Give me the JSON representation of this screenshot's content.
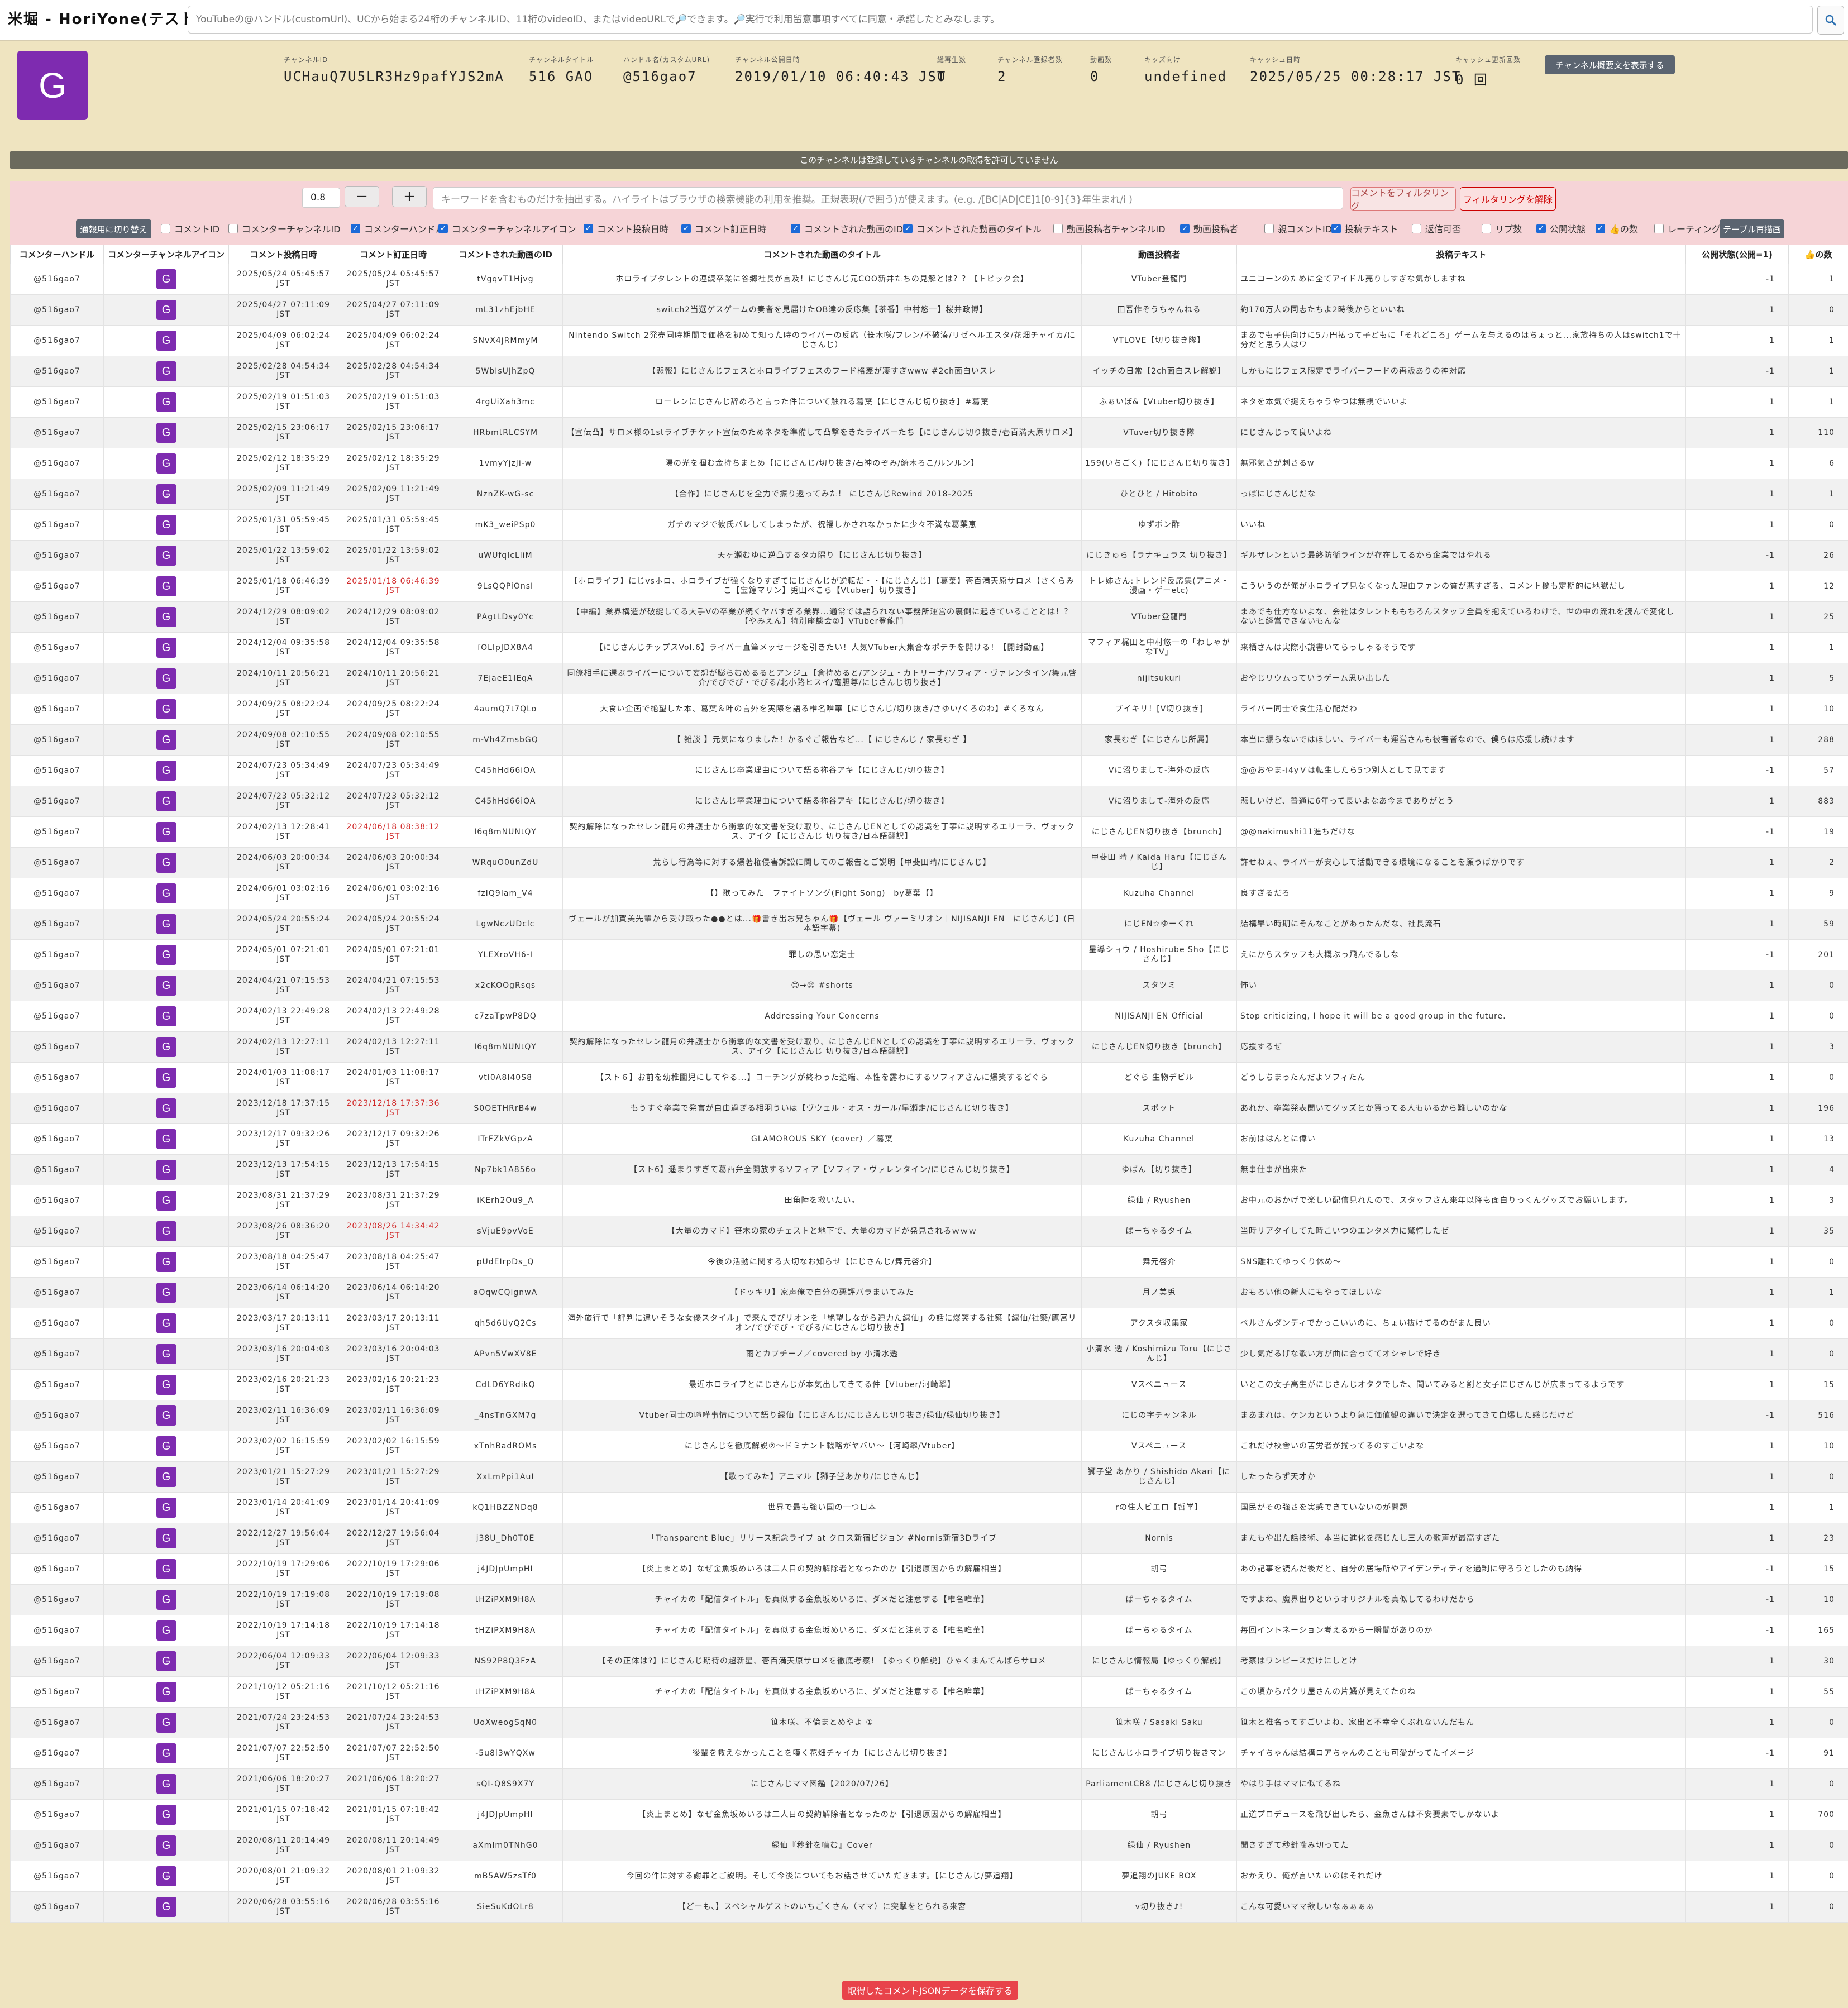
{
  "app": {
    "title": "米堀 - HoriYone(テスト中)",
    "search_placeholder": "YouTubeの@ハンドル(customUrl)、UCから始まる24桁のチャンネルID、11桁のvideoID、またはvideoURLで🔎できます。🔎実行で利用留意事項すべてに同意・承諾したとみなします。",
    "search_icon": "search-icon"
  },
  "channel": {
    "avatar_letter": "G",
    "fields": [
      {
        "label": "チャンネルID",
        "value": "UCHauQ7U5LR3Hz9pafYJS2mA"
      },
      {
        "label": "チャンネルタイトル",
        "value": "516 GAO"
      },
      {
        "label": "ハンドル名(カスタムURL)",
        "value": "@516gao7"
      },
      {
        "label": "チャンネル公開日時",
        "value": "2019/01/10 06:40:43 JST"
      },
      {
        "label": "総再生数",
        "value": "0"
      },
      {
        "label": "チャンネル登録者数",
        "value": "2"
      },
      {
        "label": "動画数",
        "value": "0"
      },
      {
        "label": "キッズ向け",
        "value": "undefined"
      },
      {
        "label": "キャッシュ日時",
        "value": "2025/05/25 00:28:17 JST"
      },
      {
        "label": "キャッシュ更新回数",
        "value": "0 回"
      }
    ],
    "desc_button": "チャンネル概要文を表示する"
  },
  "banner": "このチャンネルは登録しているチャンネルの取得を許可していません",
  "filter": {
    "threshold": "0.8",
    "minus": "−",
    "plus": "+",
    "keyword_placeholder": "キーワードを含むものだけを抽出する。ハイライトはブラウザの検索機能の利用を推奨。正規表現(/で囲う)が使えます。(e.g. /[BC|AD|CE]1[0-9]{3}年生まれ/i )",
    "filter_button": "コメントをフィルタリング",
    "clear_button": "フィルタリングを解除",
    "mode_button": "通報用に切り替え",
    "redraw_button": "テーブル再描画",
    "checkboxes": [
      {
        "label": "コメントID",
        "checked": false
      },
      {
        "label": "コメンターチャンネルID",
        "checked": false
      },
      {
        "label": "コメンターハンドル",
        "checked": true
      },
      {
        "label": "コメンターチャンネルアイコン",
        "checked": true
      },
      {
        "label": "コメント投稿日時",
        "checked": true
      },
      {
        "label": "コメント訂正日時",
        "checked": true
      },
      {
        "label": "コメントされた動画のID",
        "checked": true
      },
      {
        "label": "コメントされた動画のタイトル",
        "checked": true
      },
      {
        "label": "動画投稿者チャンネルID",
        "checked": false
      },
      {
        "label": "動画投稿者",
        "checked": true
      },
      {
        "label": "親コメントID",
        "checked": false
      },
      {
        "label": "投稿テキスト",
        "checked": true
      },
      {
        "label": "返信可否",
        "checked": false
      },
      {
        "label": "リプ数",
        "checked": false
      },
      {
        "label": "公開状態",
        "checked": true
      },
      {
        "label": "👍の数",
        "checked": true
      },
      {
        "label": "レーティング",
        "checked": false
      }
    ]
  },
  "table": {
    "headers": [
      "コメンターハンドル",
      "コメンターチャンネルアイコン",
      "コメント投稿日時",
      "コメント訂正日時",
      "コメントされた動画のID",
      "コメントされた動画のタイトル",
      "動画投稿者",
      "投稿テキスト",
      "公開状態(公開=1)",
      "👍の数"
    ],
    "rows": [
      [
        "@516gao7",
        "G",
        "2025/05/24 05:45:57 JST",
        "2025/05/24 05:45:57 JST",
        "tVgqvT1Hjvg",
        "ホロライブタレントの連続卒業に谷郷社長が言及！にじさんじ元COO新井たちの見解とは？？【トピック会】",
        "VTuber登龍門",
        "ユニコーンのために全てアイドル売りしすぎな気がしますね",
        "-1",
        "1",
        false
      ],
      [
        "@516gao7",
        "G",
        "2025/04/27 07:11:09 JST",
        "2025/04/27 07:11:09 JST",
        "mL31zhEjbHE",
        "switch2当選ゲスゲームの奏者を見届けたOB達の反応集【茶番】中村悠一】桜井政博】",
        "田吾作ぞうちゃんねる",
        "約170万人の同志たちよ2時後からといいね",
        "1",
        "0",
        false
      ],
      [
        "@516gao7",
        "G",
        "2025/04/09 06:02:24 JST",
        "2025/04/09 06:02:24 JST",
        "SNvX4jRMmyM",
        "Nintendo Switch 2発売同時期間で価格を初めて知った時のライバーの反応（笹木咲/フレン/不破湊/リゼヘルエスタ/花畑チャイカ/にじさんじ）",
        "VTLOVE【切り抜き隊】",
        "まあでも子供向けに5万円払って子どもに「それどころ」ゲームを与えるのはちょっと...家族持ちの人はswitch1で十分だと思う人はワ",
        "1",
        "1",
        false
      ],
      [
        "@516gao7",
        "G",
        "2025/02/28 04:54:34 JST",
        "2025/02/28 04:54:34 JST",
        "5WbIsUJhZpQ",
        "【悲報】にじさんじフェスとホロライブフェスのフード格差が凄すぎwww #2ch面白いスレ",
        "イッチの日常【2ch面白スレ解説】",
        "しかもにじフェス限定でライバーフードの再販ありの神対応",
        "-1",
        "1",
        false
      ],
      [
        "@516gao7",
        "G",
        "2025/02/19 01:51:03 JST",
        "2025/02/19 01:51:03 JST",
        "4rgUiXah3mc",
        "ローレンにじさんじ辞めろと言った件について触れる葛葉【にじさんじ切り抜き】#葛葉",
        "ふぁいぼ&【Vtuber切り抜き】",
        "ネタを本気で捉えちゃうやつは無視でいいよ",
        "1",
        "1",
        false
      ],
      [
        "@516gao7",
        "G",
        "2025/02/15 23:06:17 JST",
        "2025/02/15 23:06:17 JST",
        "HRbmtRLCSYM",
        "【宣伝凸】サロメ様の1stライブチケット宣伝のためネタを準備して凸撃をきたライバーたち【にじさんじ切り抜き/壱百満天原サロメ】",
        "VTuver切り抜き隊",
        "にじさんじって良いよね",
        "1",
        "110",
        false
      ],
      [
        "@516gao7",
        "G",
        "2025/02/12 18:35:29 JST",
        "2025/02/12 18:35:29 JST",
        "1vmyYjzJi-w",
        "陽の光を掴む金持ちまとめ【にじさんじ/切り抜き/石神のぞみ/綺木ろこ/ルンルン】",
        "159(いちごく)【にじさんじ切り抜き】",
        "無邪気さが刺さるw",
        "1",
        "6",
        false
      ],
      [
        "@516gao7",
        "G",
        "2025/02/09 11:21:49 JST",
        "2025/02/09 11:21:49 JST",
        "NznZK-wG-sc",
        "【合作】にじさんじを全力で振り返ってみた！ にじさんじRewind 2018-2025",
        "ひとひと / Hitobito",
        "っぱにじさんじだな",
        "1",
        "1",
        false
      ],
      [
        "@516gao7",
        "G",
        "2025/01/31 05:59:45 JST",
        "2025/01/31 05:59:45 JST",
        "mK3_weiPSp0",
        "ガチのマジで彼氏バレしてしまったが、祝福しかされなかったに少々不満な葛葉恵",
        "ゆずポン酢",
        "いいね",
        "1",
        "0",
        false
      ],
      [
        "@516gao7",
        "G",
        "2025/01/22 13:59:02 JST",
        "2025/01/22 13:59:02 JST",
        "uWUfqIcLliM",
        "天ヶ瀬むゆに逆凸するタカ隅り【にじさんじ切り抜き】",
        "にじきゅら【ラナキュラス 切り抜き】",
        "ギルザレンという最終防衛ラインが存在してるから企業ではやれる",
        "-1",
        "26",
        false
      ],
      [
        "@516gao7",
        "G",
        "2025/01/18 06:46:39 JST",
        "2025/01/18 06:46:39 JST",
        "9LsQQPiOnsI",
        "【ホロライブ】にじvsホロ、ホロライブが強くなりすぎてにじさんじが逆転だ・・【にじさんじ】【葛葉】壱百満天原サロメ【さくらみこ【宝鐘マリン】兎田ぺこら【Vtuber】切り抜き】",
        "トレ姉さん:トレンド反応集(アニメ・漫画・ゲーetc)",
        "こういうのが俺がホロライブ見なくなった理由ファンの質が悪すぎる、コメント欄も定期的に地獄だし",
        "1",
        "12",
        true
      ],
      [
        "@516gao7",
        "G",
        "2024/12/29 08:09:02 JST",
        "2024/12/29 08:09:02 JST",
        "PAgtLDsy0Yc",
        "【中編】業界構造が破綻してる大手Vの卒業が続くヤバすぎる業界...通常では語られない事務所運営の裏側に起きていることとは！？【やみえん】特別座談会②】VTuber登龍門",
        "VTuber登龍門",
        "まあでも仕方ないよな、会社はタレントももちろんスタッフ全員を抱えているわけで、世の中の流れを読んで変化しないと経営できないもんな",
        "1",
        "25",
        false
      ],
      [
        "@516gao7",
        "G",
        "2024/12/04 09:35:58 JST",
        "2024/12/04 09:35:58 JST",
        "fOLIpJDX8A4",
        "【にじさんじチップスVol.6】ライバー直筆メッセージを引きたい！人気VTuber大集合なポテチを開ける！【開封動画】",
        "マフィア梶田と中村悠一の「わしゃがなTV」",
        "来栖さんは実際小説書いてらっしゃるそうです",
        "1",
        "1",
        false
      ],
      [
        "@516gao7",
        "G",
        "2024/10/11 20:56:21 JST",
        "2024/10/11 20:56:21 JST",
        "7EjaeE1IEqA",
        "同僚相手に選ぶライバーについて妄想が膨らむめるるとアンジュ【倉持めると/アンジュ・カトリーナ/ソフィア・ヴァレンタイン/舞元啓介/でびでび・でびる/北小路ヒスイ/竜胆尊/にじさんじ切り抜き】",
        "nijitsukuri",
        "おやじリウムっていうゲーム思い出した",
        "1",
        "5",
        false
      ],
      [
        "@516gao7",
        "G",
        "2024/09/25 08:22:24 JST",
        "2024/09/25 08:22:24 JST",
        "4aumQ7t7QLo",
        "大食い企画で絶望した本、葛葉＆叶の言外を実際を語る椎名唯華【にじさんじ/切り抜き/さゆい/くろのわ】#くろなん",
        "ブイキリ！[V切り抜き]",
        "ライバー同士で食生活心配だわ",
        "1",
        "10",
        false
      ],
      [
        "@516gao7",
        "G",
        "2024/09/08 02:10:55 JST",
        "2024/09/08 02:10:55 JST",
        "m-Vh4ZmsbGQ",
        "【 雑談 】元気になりました！かるぐご報告など...【 にじさんじ / 家長むぎ 】",
        "家長むぎ【にじさんじ所属】",
        "本当に振らないではほしい、ライバーも運営さんも被害者なので、僕らは応援し続けます",
        "1",
        "288",
        false
      ],
      [
        "@516gao7",
        "G",
        "2024/07/23 05:34:49 JST",
        "2024/07/23 05:34:49 JST",
        "C45hHd66iOA",
        "にじさんじ卒業理由について語る祢谷アキ【にじさんじ/切り抜き】",
        "Vに沼りまして-海外の反応",
        "@@おやま-i4yＶは転生したら5つ別人として見てます",
        "-1",
        "57",
        false
      ],
      [
        "@516gao7",
        "G",
        "2024/07/23 05:32:12 JST",
        "2024/07/23 05:32:12 JST",
        "C45hHd66iOA",
        "にじさんじ卒業理由について語る祢谷アキ【にじさんじ/切り抜き】",
        "Vに沼りまして-海外の反応",
        "悲しいけど、普通に6年って長いよなあ今までありがとう",
        "1",
        "883",
        false
      ],
      [
        "@516gao7",
        "G",
        "2024/02/13 12:28:41 JST",
        "2024/06/18 08:38:12 JST",
        "I6q8mNUNtQY",
        "契約解除になったセレン龍月の弁護士から衝撃的な文書を受け取り、にじさんじENとしての認識を丁寧に説明するエリーラ、ヴォックス、アイク【にじさんじ 切り抜き/日本語翻訳】",
        "にじさんじEN切り抜き【brunch】",
        "@@nakimushi11進ちだけな",
        "-1",
        "19",
        true
      ],
      [
        "@516gao7",
        "G",
        "2024/06/03 20:00:34 JST",
        "2024/06/03 20:00:34 JST",
        "WRquO0unZdU",
        "荒らし行為等に対する爆著権侵害訴訟に関してのご報告とご説明【甲斐田晴/にじさんじ】",
        "甲斐田 晴 / Kaida Haru【にじさんじ】",
        "許せねぇ、ライバーが安心して活動できる環境になることを願うばかりです",
        "1",
        "2",
        false
      ],
      [
        "@516gao7",
        "G",
        "2024/06/01 03:02:16 JST",
        "2024/06/01 03:02:16 JST",
        "fzIQ9Iam_V4",
        "【】歌ってみた　ファイトソング(Fight Song)　by葛葉【】",
        "Kuzuha Channel",
        "良すぎるだろ",
        "1",
        "9",
        false
      ],
      [
        "@516gao7",
        "G",
        "2024/05/24 20:55:24 JST",
        "2024/05/24 20:55:24 JST",
        "LgwNczUDclc",
        "ヴェールが加賀美先輩から受け取った●●とは...🎁書き出お兄ちゃん🎁【ヴェール ヴァーミリオン｜NIJISANJI EN｜にじさんじ】(日本語字幕)",
        "にじEN☆ゆーくれ",
        "結構早い時期にそんなことがあったんだな、社長流石",
        "1",
        "59",
        false
      ],
      [
        "@516gao7",
        "G",
        "2024/05/01 07:21:01 JST",
        "2024/05/01 07:21:01 JST",
        "YLEXroVH6-I",
        "罪しの思い恋定士",
        "星導ショウ / Hoshirube Sho【にじさんじ】",
        "えにからスタッフも大概ぶっ飛んでるしな",
        "-1",
        "201",
        false
      ],
      [
        "@516gao7",
        "G",
        "2024/04/21 07:15:53 JST",
        "2024/04/21 07:15:53 JST",
        "x2cKOOgRsqs",
        "😊→😡 #shorts",
        "スタツミ",
        "怖い",
        "1",
        "0",
        false
      ],
      [
        "@516gao7",
        "G",
        "2024/02/13 22:49:28 JST",
        "2024/02/13 22:49:28 JST",
        "c7zaTpwP8DQ",
        "Addressing Your Concerns",
        "NIJISANJI EN Official",
        "Stop criticizing, I hope it will be a good group in the future.",
        "1",
        "0",
        false
      ],
      [
        "@516gao7",
        "G",
        "2024/02/13 12:27:11 JST",
        "2024/02/13 12:27:11 JST",
        "I6q8mNUNtQY",
        "契約解除になったセレン龍月の弁護士から衝撃的な文書を受け取り、にじさんじENとしての認識を丁寧に説明するエリーラ、ヴォックス、アイク【にじさんじ 切り抜き/日本語翻訳】",
        "にじさんじEN切り抜き【brunch】",
        "応援するぜ",
        "1",
        "3",
        false
      ],
      [
        "@516gao7",
        "G",
        "2024/01/03 11:08:17 JST",
        "2024/01/03 11:08:17 JST",
        "vtI0A8I40S8",
        "【スト６】お前を幼稚園児にしてやる...】コーチングが終わった途端、本性を露わにするソフィアさんに爆笑するどぐら",
        "どぐら 生物デビル",
        "どうしちまったんだよソフィたん",
        "1",
        "0",
        false
      ],
      [
        "@516gao7",
        "G",
        "2023/12/18 17:37:15 JST",
        "2023/12/18 17:37:36 JST",
        "S0OETHRrB4w",
        "もうすぐ卒業で発言が自由過ぎる相羽ういは【ヴウェル・オス・ガール/早瀬走/にじさんじ切り抜き】",
        "スポット",
        "あれか、卒業発表聞いてグッズとか買ってる人もいるから難しいのかな",
        "1",
        "196",
        true
      ],
      [
        "@516gao7",
        "G",
        "2023/12/17 09:32:26 JST",
        "2023/12/17 09:32:26 JST",
        "ITrFZkVGpzA",
        "GLAMOROUS SKY（cover）／葛葉",
        "Kuzuha Channel",
        "お前ははんとに偉い",
        "1",
        "13",
        false
      ],
      [
        "@516gao7",
        "G",
        "2023/12/13 17:54:15 JST",
        "2023/12/13 17:54:15 JST",
        "Np7bk1A856o",
        "【スト6】遥まりすぎて葛西弁全開放するソフィア【ソフィア・ヴァレンタイン/にじさんじ切り抜き】",
        "ゆばん【切り抜き】",
        "無事仕事が出来た",
        "1",
        "4",
        false
      ],
      [
        "@516gao7",
        "G",
        "2023/08/31 21:37:29 JST",
        "2023/08/31 21:37:29 JST",
        "iKErh2Ou9_A",
        "田角陸を救いたい。",
        "緑仙 / Ryushen",
        "お中元のおかげで楽しい配信見れたので、スタッフさん来年以降も面白りっくんグッズでお願いします。",
        "1",
        "3",
        false
      ],
      [
        "@516gao7",
        "G",
        "2023/08/26 08:36:20 JST",
        "2023/08/26 14:34:42 JST",
        "sVjuE9pvVoE",
        "【大量のカマド】笹木の家のチェストと地下で、大量のカマドが発見されるｗｗｗ",
        "ばーちゃるタイム",
        "当時リアタイしてた時こいつのエンタメ力に驚愕したぜ",
        "1",
        "35",
        true
      ],
      [
        "@516gao7",
        "G",
        "2023/08/18 04:25:47 JST",
        "2023/08/18 04:25:47 JST",
        "pUdEIrpDs_Q",
        "今後の活動に関する大切なお知らせ【にじさんじ/舞元啓介】",
        "舞元啓介",
        "SNS離れてゆっくり休め〜",
        "1",
        "0",
        false
      ],
      [
        "@516gao7",
        "G",
        "2023/06/14 06:14:20 JST",
        "2023/06/14 06:14:20 JST",
        "aOqwCQignwA",
        "【ドッキリ】家声俺で自分の悪評バラまいてみた",
        "月ノ美兎",
        "おもろい他の新人にもやってほしいな",
        "1",
        "1",
        false
      ],
      [
        "@516gao7",
        "G",
        "2023/03/17 20:13:11 JST",
        "2023/03/17 20:13:11 JST",
        "qh5d6UyQ2Cs",
        "海外旅行で「評判に違いそうな女優スタイル」で来たでびリオンを「絶望しながら迫力た緑仙」の話に爆笑する社築【緑仙/社築/鷹宮リオン/でびでび・でびる/にじさんじ切り抜き】",
        "アクスタ収集家",
        "べルさんダンディでかっこいいのに、ちょい抜けてるのがまた良い",
        "1",
        "0",
        false
      ],
      [
        "@516gao7",
        "G",
        "2023/03/16 20:04:03 JST",
        "2023/03/16 20:04:03 JST",
        "APvn5VwXV8E",
        "雨とカプチーノ／covered by 小清水透",
        "小清水 透 / Koshimizu Toru【にじさんじ】",
        "少し気だるげな歌い方が曲に合っててオシャレで好き",
        "1",
        "0",
        false
      ],
      [
        "@516gao7",
        "G",
        "2023/02/16 20:21:23 JST",
        "2023/02/16 20:21:23 JST",
        "CdLD6YRdikQ",
        "最近ホロライブとにじさんじが本気出してきてる件【Vtuber/河崎翆】",
        "Vスペニュース",
        "いとこの女子高生がにじさんじオタクでした、聞いてみると割と女子にじさんじが広まってるようです",
        "1",
        "15",
        false
      ],
      [
        "@516gao7",
        "G",
        "2023/02/11 16:36:09 JST",
        "2023/02/11 16:36:09 JST",
        "_4nsTnGXM7g",
        "Vtuber同士の喧嘩事情について語り緑仙【にじさんじ/にじさんじ切り抜き/緑仙/緑仙切り抜き】",
        "にじの字チャンネル",
        "まあまれは、ケンカというより急に価値観の違いで決定を選ってきて自爆した感じだけど",
        "-1",
        "516",
        false
      ],
      [
        "@516gao7",
        "G",
        "2023/02/02 16:15:59 JST",
        "2023/02/02 16:15:59 JST",
        "xTnhBadROMs",
        "にじさんじを徹底解説②〜ドミナント戦略がヤバい〜【河崎翆/Vtuber】",
        "Vスペニュース",
        "これだけ校舎いの苦労者が揃ってるのすごいよな",
        "1",
        "10",
        false
      ],
      [
        "@516gao7",
        "G",
        "2023/01/21 15:27:29 JST",
        "2023/01/21 15:27:29 JST",
        "XxLmPpi1AuI",
        "【歌ってみた】アニマル【獅子堂あかり/にじさんじ】",
        "獅子堂 あかり / Shishido Akari【にじさんじ】",
        "したったらず天才か",
        "1",
        "0",
        false
      ],
      [
        "@516gao7",
        "G",
        "2023/01/14 20:41:09 JST",
        "2023/01/14 20:41:09 JST",
        "kQ1HBZZNDq8",
        "世界で最も強い国の一つ日本",
        "rの住人ビエロ【哲学】",
        "国民がその強さを実感できていないのが問題",
        "1",
        "1",
        false
      ],
      [
        "@516gao7",
        "G",
        "2022/12/27 19:56:04 JST",
        "2022/12/27 19:56:04 JST",
        "j38U_Dh0T0E",
        "「Transparent Blue」リリース記念ライブ at クロス新宿ビジョン #Nornis新宿3Dライブ",
        "Nornis",
        "またもや出た話技術、本当に進化を感じたし三人の歌声が最高すぎた",
        "1",
        "23",
        false
      ],
      [
        "@516gao7",
        "G",
        "2022/10/19 17:29:06 JST",
        "2022/10/19 17:29:06 JST",
        "j4JDJpUmpHI",
        "【炎上まとめ】なぜ金魚坂めいろは二人目の契約解除者となったのか【引退原因からの解雇相当】",
        "胡弓",
        "あの記事を読んだ後だと、自分の居場所やアイデンティティを過剰に守ろうとしたのも納得",
        "-1",
        "15",
        false
      ],
      [
        "@516gao7",
        "G",
        "2022/10/19 17:19:08 JST",
        "2022/10/19 17:19:08 JST",
        "tHZiPXM9H8A",
        "チャイカの「配信タイトル」を真似する金魚坂めいろに、ダメだと注意する【椎名唯華】",
        "ばーちゃるタイム",
        "ですよね、魔界出りというオリジナルを真似してるわけだから",
        "-1",
        "10",
        false
      ],
      [
        "@516gao7",
        "G",
        "2022/10/19 17:14:18 JST",
        "2022/10/19 17:14:18 JST",
        "tHZiPXM9H8A",
        "チャイカの「配信タイトル」を真似する金魚坂めいろに、ダメだと注意する【椎名唯華】",
        "ばーちゃるタイム",
        "毎回イントネーション考えるから一瞬間がありのか",
        "-1",
        "165",
        false
      ],
      [
        "@516gao7",
        "G",
        "2022/06/04 12:09:33 JST",
        "2022/06/04 12:09:33 JST",
        "NS92P8Q3FzA",
        "【その正体は?】にじさんじ期待の超新星、壱百満天原サロメを徹底考察！【ゆっくり解説】ひゃくまんてんばらサロメ",
        "にじさんじ情報局【ゆっくり解説】",
        "考察はワンピースだけにしとけ",
        "1",
        "30",
        false
      ],
      [
        "@516gao7",
        "G",
        "2021/10/12 05:21:16 JST",
        "2021/10/12 05:21:16 JST",
        "tHZiPXM9H8A",
        "チャイカの「配信タイトル」を真似する金魚坂めいろに、ダメだと注意する【椎名唯華】",
        "ばーちゃるタイム",
        "この頃からパクリ屋さんの片鱗が見えてたのね",
        "1",
        "55",
        false
      ],
      [
        "@516gao7",
        "G",
        "2021/07/24 23:24:53 JST",
        "2021/07/24 23:24:53 JST",
        "UoXweogSqN0",
        "笹木咲、不倫まとめやよ ①",
        "笹木咲 / Sasaki Saku",
        "笹木と椎名ってすごいよね、家出と不幸全くぶれないんだもん",
        "1",
        "0",
        false
      ],
      [
        "@516gao7",
        "G",
        "2021/07/07 22:52:50 JST",
        "2021/07/07 22:52:50 JST",
        "-5u8l3wYQXw",
        "後輩を救えなかったことを嘆く花畑チャイカ【にじさんじ切り抜き】",
        "にじさんじホロライブ切り抜きマン",
        "チャイちゃんは結構ロアちゃんのことも可愛がってたイメージ",
        "-1",
        "91",
        false
      ],
      [
        "@516gao7",
        "G",
        "2021/06/06 18:20:27 JST",
        "2021/06/06 18:20:27 JST",
        "sQI-Q8S9X7Y",
        "にじさんじママ図鑑【2020/07/26】",
        "ParliamentCB8 /にじさんじ切り抜き",
        "やはり手はママに似てるね",
        "1",
        "0",
        false
      ],
      [
        "@516gao7",
        "G",
        "2021/01/15 07:18:42 JST",
        "2021/01/15 07:18:42 JST",
        "j4JDJpUmpHI",
        "【炎上まとめ】なぜ金魚坂めいろは二人目の契約解除者となったのか【引退原因からの解雇相当】",
        "胡弓",
        "正道プロデュースを飛び出したら、金魚さんは不安要素でしかないよ",
        "1",
        "700",
        false
      ],
      [
        "@516gao7",
        "G",
        "2020/08/11 20:14:49 JST",
        "2020/08/11 20:14:49 JST",
        "aXmIm0TNhG0",
        "緑仙『秒針を噛む』Cover",
        "緑仙 / Ryushen",
        "聞きすぎて秒針噛み切ってた",
        "1",
        "0",
        false
      ],
      [
        "@516gao7",
        "G",
        "2020/08/01 21:09:32 JST",
        "2020/08/01 21:09:32 JST",
        "mB5AW5zsTf0",
        "今回の件に対する謝罪とご説明。そして今後についてもお話させていただきます。【にじさんじ/夢追翔】",
        "夢追翔のJUKE BOX",
        "おかえり、俺が言いたいのはそれだけ",
        "1",
        "0",
        false
      ],
      [
        "@516gao7",
        "G",
        "2020/06/28 03:55:16 JST",
        "2020/06/28 03:55:16 JST",
        "SieSuKdOLr8",
        "【どーも、】スペシャルゲストのいちごくさん（ママ）に突撃をとられる来宮",
        "v切り抜き♪!",
        "こんな可愛いママ欲しいなぁぁぁぁ",
        "1",
        "0",
        false
      ]
    ]
  },
  "footer": {
    "save_button": "取得したコメントJSONデータを保存する"
  }
}
